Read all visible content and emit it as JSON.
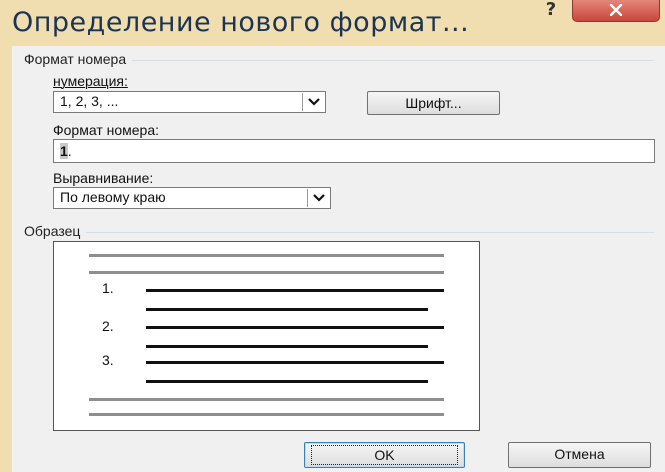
{
  "dialog": {
    "title": "Определение нового формат...",
    "help_label": "?"
  },
  "number_format_group": {
    "legend": "Формат номера",
    "numbering_label": "нумерация:",
    "numbering_value": "1, 2, 3, ...",
    "font_button": "Шрифт...",
    "format_label": "Формат номера:",
    "format_value_selected": "1",
    "format_value_rest": ".",
    "alignment_label": "Выравнивание:",
    "alignment_value": "По левому краю"
  },
  "sample_group": {
    "legend": "Образец",
    "numbers": [
      "1.",
      "2.",
      "3."
    ]
  },
  "footer": {
    "ok_label": "OK",
    "cancel_label": "Отмена"
  },
  "colors": {
    "frame": "#f0ddb0",
    "title_text": "#1b3453",
    "close": "#c8463a"
  }
}
